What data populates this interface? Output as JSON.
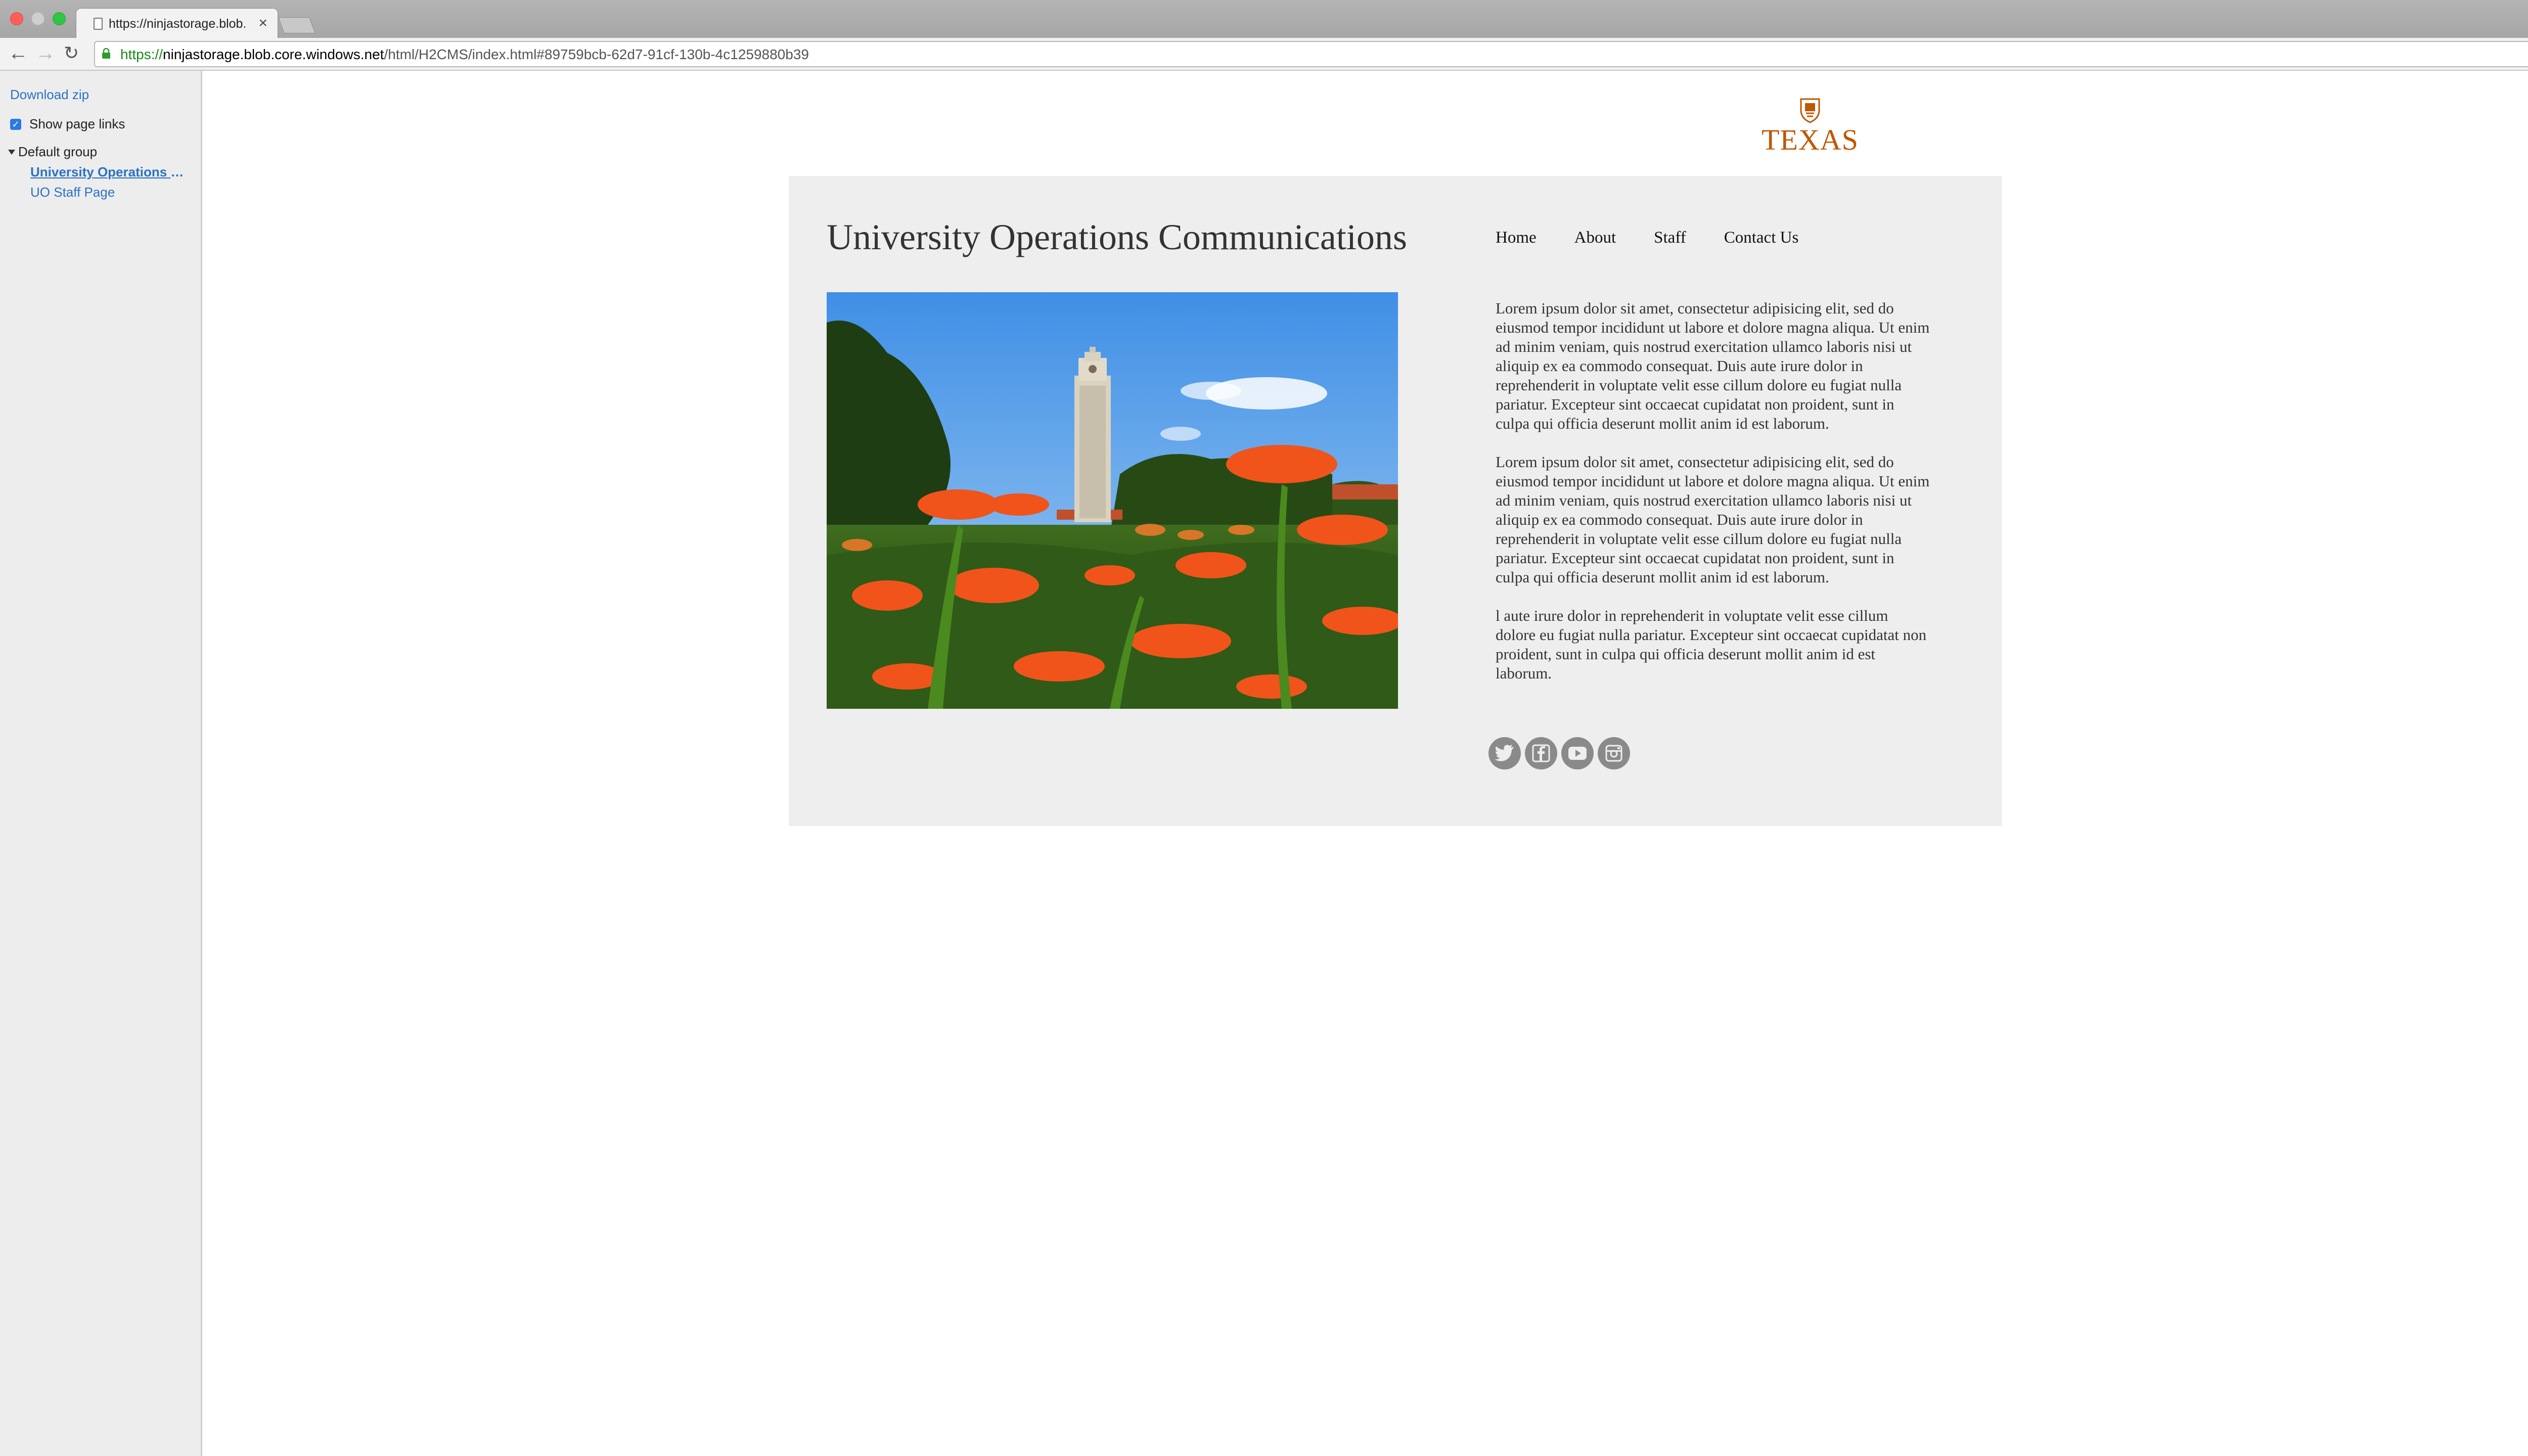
{
  "browser": {
    "tab_title": "https://ninjastorage.blob.c",
    "tab_close": "×",
    "url": {
      "scheme": "https://",
      "host": "ninjastorage.blob.core.windows.net",
      "rest": "/html/H2CMS/index.html#89759bcb-62d7-91cf-130b-4c1259880b39"
    },
    "star": "☆",
    "back": "←",
    "forward": "→",
    "reload": "↻"
  },
  "sidebar": {
    "download_label": "Download zip",
    "show_links_label": "Show page links",
    "show_links_checked": true,
    "group_label": "Default group",
    "pages": [
      "University Operations Communications",
      "UO Staff Page"
    ]
  },
  "site": {
    "logo_text": "TEXAS",
    "logo_color": "#bf5700",
    "title": "University Operations Communications",
    "nav": [
      "Home",
      "About",
      "Staff",
      "Contact Us"
    ],
    "paragraphs": [
      "Lorem ipsum dolor sit amet, consectetur adipisicing elit, sed do eiusmod tempor incididunt ut labore et dolore magna aliqua. Ut enim ad minim veniam, quis nostrud exercitation ullamco laboris nisi ut aliquip ex ea commodo consequat. Duis aute irure dolor in reprehenderit in voluptate velit esse cillum dolore eu fugiat nulla pariatur. Excepteur sint occaecat cupidatat non proident, sunt in culpa qui officia deserunt mollit anim id est laborum.",
      "Lorem ipsum dolor sit amet, consectetur adipisicing elit, sed do eiusmod tempor incididunt ut labore et dolore magna aliqua. Ut enim ad minim veniam, quis nostrud exercitation ullamco laboris nisi ut aliquip ex ea commodo consequat. Duis aute irure dolor in reprehenderit in voluptate velit esse cillum dolore eu fugiat nulla pariatur. Excepteur sint occaecat cupidatat non proident, sunt in culpa qui officia deserunt mollit anim id est laborum.",
      "l aute irure dolor in reprehenderit in voluptate velit esse cillum dolore eu fugiat nulla pariatur. Excepteur sint occaecat cupidatat non proident, sunt in culpa qui officia deserunt mollit anim id est laborum."
    ],
    "social_icons": [
      "twitter-icon",
      "facebook-icon",
      "youtube-icon",
      "instagram-icon"
    ]
  }
}
